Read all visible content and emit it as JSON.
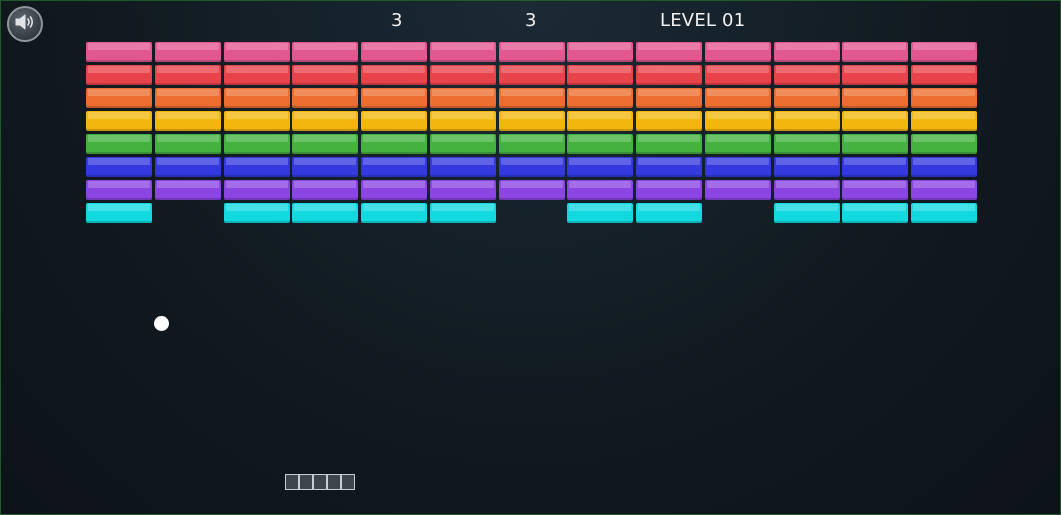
{
  "hud": {
    "score": "3",
    "lives": "3",
    "level": "LEVEL 01"
  },
  "sound_button": {
    "icon": "speaker-icon"
  },
  "bricks": {
    "columns": 13,
    "rows": [
      {
        "color": "#e2578f",
        "present": [
          1,
          1,
          1,
          1,
          1,
          1,
          1,
          1,
          1,
          1,
          1,
          1,
          1
        ]
      },
      {
        "color": "#e8434a",
        "present": [
          1,
          1,
          1,
          1,
          1,
          1,
          1,
          1,
          1,
          1,
          1,
          1,
          1
        ]
      },
      {
        "color": "#ec6d2f",
        "present": [
          1,
          1,
          1,
          1,
          1,
          1,
          1,
          1,
          1,
          1,
          1,
          1,
          1
        ]
      },
      {
        "color": "#f2b60c",
        "present": [
          1,
          1,
          1,
          1,
          1,
          1,
          1,
          1,
          1,
          1,
          1,
          1,
          1
        ]
      },
      {
        "color": "#45b240",
        "present": [
          1,
          1,
          1,
          1,
          1,
          1,
          1,
          1,
          1,
          1,
          1,
          1,
          1
        ]
      },
      {
        "color": "#3438df",
        "present": [
          1,
          1,
          1,
          1,
          1,
          1,
          1,
          1,
          1,
          1,
          1,
          1,
          1
        ]
      },
      {
        "color": "#8a45e3",
        "present": [
          1,
          1,
          1,
          1,
          1,
          1,
          1,
          1,
          1,
          1,
          1,
          1,
          1
        ]
      },
      {
        "color": "#12d9e0",
        "present": [
          1,
          0,
          1,
          1,
          1,
          1,
          0,
          1,
          1,
          0,
          1,
          1,
          1
        ]
      }
    ]
  },
  "ball": {
    "color": "#ffffff"
  },
  "paddle": {
    "segments": 5
  }
}
